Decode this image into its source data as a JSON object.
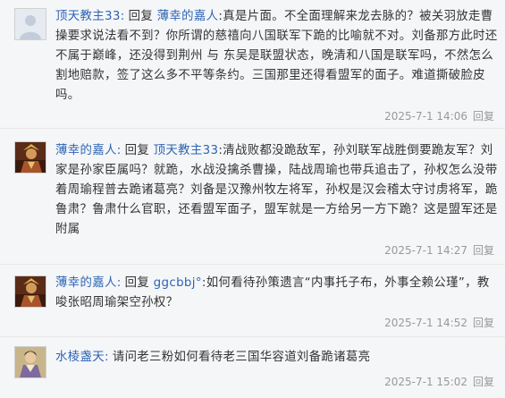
{
  "colors": {
    "link": "#2d64b3",
    "meta": "#999999",
    "background": "#f5f6f8",
    "divider": "#e8e8e8"
  },
  "replies": [
    {
      "avatar_icon": "default-user-avatar-icon",
      "author": "顶天教主33:",
      "action": "回复",
      "target": "薄幸的嘉人",
      "text": ":真是片面。不全面理解来龙去脉的？被关羽放走曹操要求说法看不到？你所谓的慈禧向八国联军下跪的比喻就不对。刘备那方此时还不属于巅峰，还没得到荆州 与 东吴是联盟状态，晚清和八国是联军吗，不然怎么割地赔款，签了这么多不平等条约。三国那里还得看盟军的面子。难道撕破脸皮吗。",
      "time": "2025-7-1 14:06",
      "reply_label": "回复"
    },
    {
      "avatar_icon": "warrior-portrait-avatar-icon",
      "author": "薄幸的嘉人:",
      "action": "回复",
      "target": "顶天教主33",
      "text": ":清战败都没跪敌军，孙刘联军战胜倒要跪友军？刘家是孙家臣属吗？就跪，水战没擒杀曹操，陆战周瑜也带兵追击了，孙权怎么没带着周瑜程普去跪诸葛亮？刘备是汉豫州牧左将军，孙权是汉会稽太守讨虏将军，跪鲁肃？鲁肃什么官职，还看盟军面子，盟军就是一方给另一方下跪？这是盟军还是附属",
      "time": "2025-7-1 14:27",
      "reply_label": "回复"
    },
    {
      "avatar_icon": "warrior-portrait-avatar-icon",
      "author": "薄幸的嘉人:",
      "action": "回复",
      "target": "ggcbbj°",
      "text": ":如何看待孙策遗言“内事托子布，外事全赖公瑾”，教唆张昭周瑜架空孙权？",
      "time": "2025-7-1 14:52",
      "reply_label": "回复"
    },
    {
      "avatar_icon": "sage-portrait-avatar-icon",
      "author": "水棱盏天:",
      "action": "",
      "target": "",
      "text": "请问老三粉如何看待老三国华容道刘备跪诸葛亮",
      "time": "2025-7-1 15:02",
      "reply_label": "回复"
    }
  ]
}
